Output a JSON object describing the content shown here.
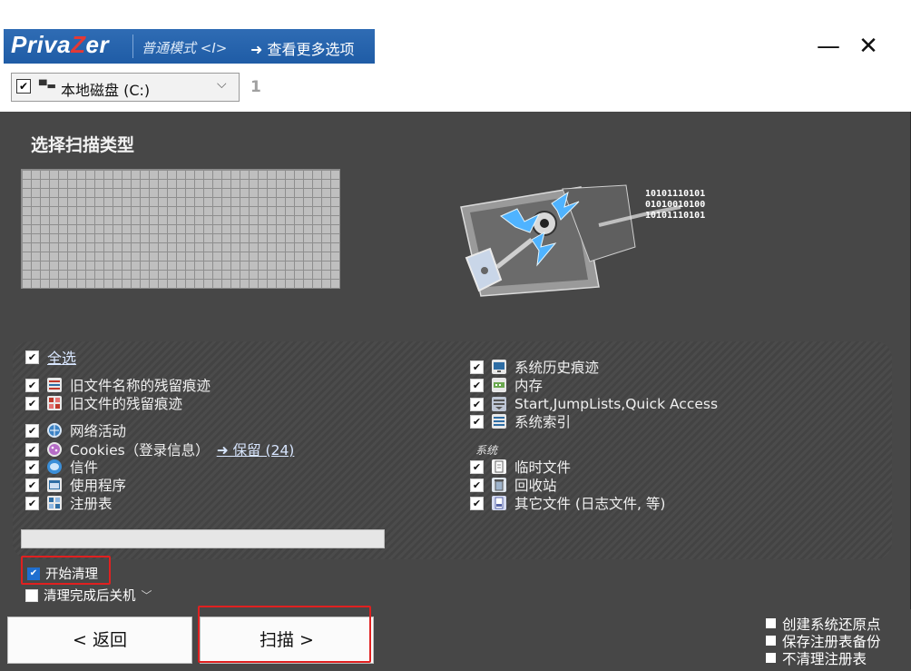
{
  "header": {
    "logo_prefix": "Priva",
    "logo_z": "Z",
    "logo_suffix": "er",
    "mode_label": "普通模式 <I>",
    "more_options_label": "➜ 查看更多选项",
    "minimize_icon": "—",
    "close_icon": "✕"
  },
  "drive": {
    "checked": true,
    "label": "本地磁盘 (C:)",
    "count": "1"
  },
  "main": {
    "section_title": "选择扫描类型",
    "binary_lines": "10101110101\n01010010100\n10101110101"
  },
  "options": {
    "select_all": "全选",
    "left": [
      {
        "label": "旧文件名称的残留痕迹",
        "icon": "file-names-icon",
        "checked": true
      },
      {
        "label": "旧文件的残留痕迹",
        "icon": "file-traces-icon",
        "checked": true
      },
      {
        "label": "网络活动",
        "icon": "globe-icon",
        "checked": true
      },
      {
        "label": "Cookies（登录信息）",
        "icon": "cookies-icon",
        "checked": true
      },
      {
        "label": "信件",
        "icon": "mail-icon",
        "checked": true
      },
      {
        "label": "使用程序",
        "icon": "program-icon",
        "checked": true
      },
      {
        "label": "注册表",
        "icon": "registry-icon",
        "checked": true
      }
    ],
    "cookies_link": "➜ 保留 (24)",
    "right": [
      {
        "label": "系统历史痕迹",
        "icon": "monitor-icon",
        "checked": true
      },
      {
        "label": "内存",
        "icon": "memory-icon",
        "checked": true
      },
      {
        "label": "Start,JumpLists,Quick Access",
        "icon": "start-menu-icon",
        "checked": true
      },
      {
        "label": "系统索引",
        "icon": "index-icon",
        "checked": true
      }
    ],
    "system_heading": "系统",
    "system": [
      {
        "label": "临时文件",
        "icon": "temp-file-icon",
        "checked": true
      },
      {
        "label": "回收站",
        "icon": "recycle-bin-icon",
        "checked": true
      },
      {
        "label": "其它文件 (日志文件, 等)",
        "icon": "other-files-icon",
        "checked": true
      }
    ]
  },
  "bottom": {
    "start_clean": "开始清理",
    "start_clean_checked": true,
    "shutdown_after": "清理完成后关机",
    "shutdown_checked": false
  },
  "footer": {
    "back": "< 返回",
    "scan": "扫描 >",
    "side_options": [
      {
        "label": "创建系统还原点",
        "checked": false
      },
      {
        "label": "保存注册表备份",
        "checked": false
      },
      {
        "label": "不清理注册表",
        "checked": false
      }
    ]
  },
  "colors": {
    "brand_blue": "#1f5ca6",
    "panel_dark": "#474747",
    "highlight_red": "#e02020"
  }
}
